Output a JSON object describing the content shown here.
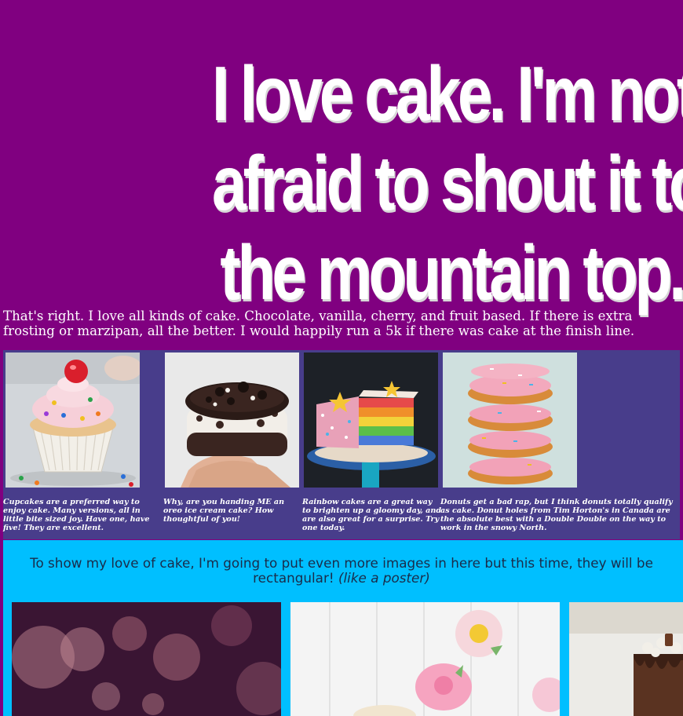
{
  "hero": {
    "line1": "I love cake. I'm not",
    "line2": "afraid to shout it to",
    "line3": "the mountain top."
  },
  "intro": "That's right. I love all kinds of cake. Chocolate, vanilla, cherry, and fruit based. If there is extra frosting or marzipan, all the better. I would happily run a 5k if there was cake at the finish line.",
  "gallery": [
    {
      "caption": "Cupcakes are a preferred way to enjoy cake. Many versions, all in little bite sized joy. Have one, have five! They are excellent."
    },
    {
      "caption": "Why, are you handing ME an oreo ice cream cake? How thoughtful of you!"
    },
    {
      "caption": "Rainbow cakes are a great way to brighten up a gloomy day, and are also great for a surprise. Try one today."
    },
    {
      "caption": "Donuts get a bad rap, but I think donuts totally qualify as cake. Donut holes from Tim Horton's in Canada are the absolute best with a Double Double on the way to work in the snowy North."
    }
  ],
  "posters": {
    "heading": "To show my love of cake, I'm going to put even more images in here but this time, they will be rectangular!",
    "heading_em": "(like a poster)"
  },
  "colors": {
    "page_bg": "#800080",
    "gallery_bg": "#483d8b",
    "poster_band_bg": "#00bfff"
  }
}
